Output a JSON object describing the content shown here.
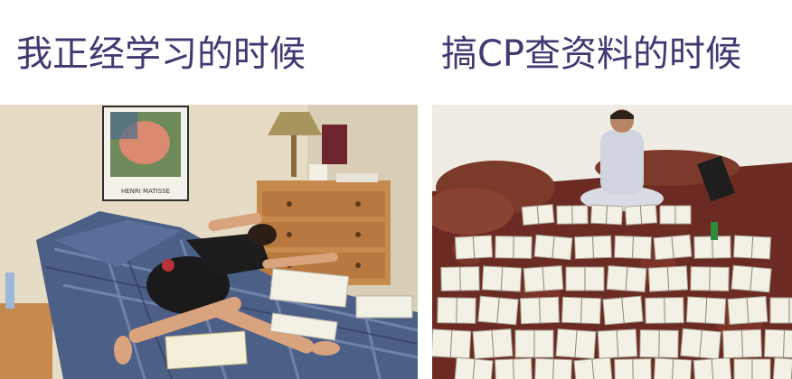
{
  "captions": {
    "left": "我正经学习的时候",
    "right": "搞CP查资料的时候"
  },
  "left_photo": {
    "poster_text": "HENRI MATISSE"
  },
  "colors": {
    "caption_text": "#3f3a72",
    "wall_left": "#e6dcc6",
    "dresser": "#c68a4d",
    "blanket": "#4c5f86",
    "wall_right": "#efece6",
    "rug": "#6b2a22",
    "book_page": "#f3f0e6"
  }
}
